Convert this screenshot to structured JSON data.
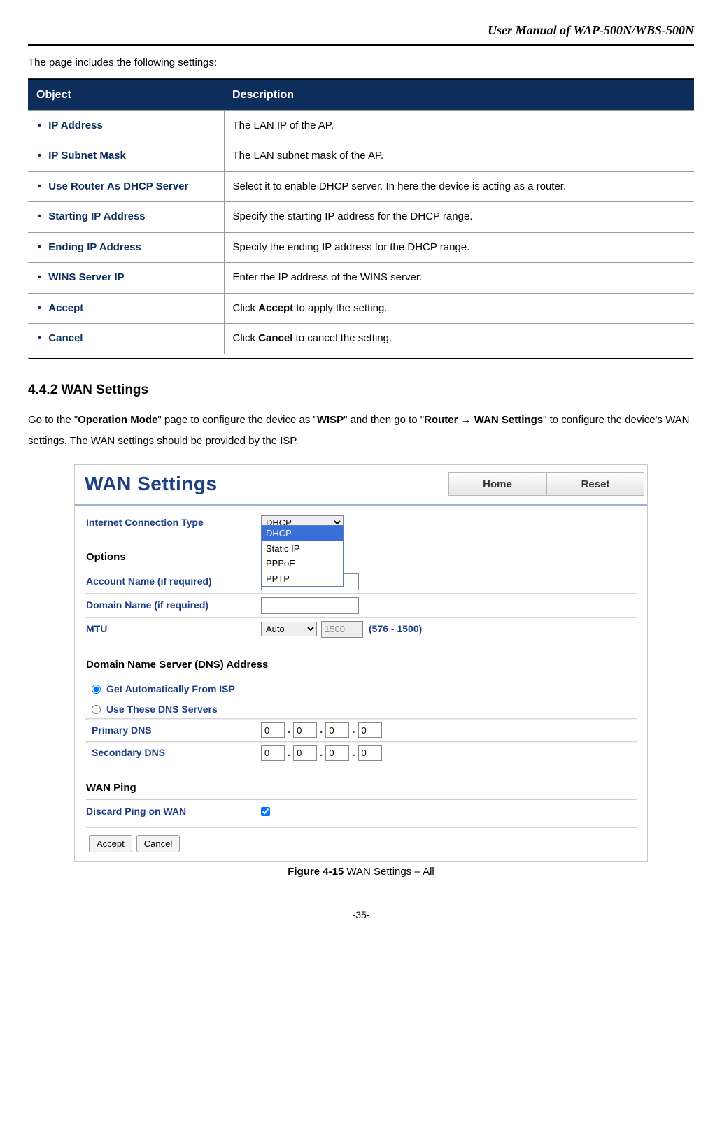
{
  "header": {
    "manual_title": "User Manual of WAP-500N/WBS-500N"
  },
  "intro": {
    "settings_text": "The page includes the following settings:"
  },
  "objtable": {
    "head_object": "Object",
    "head_desc": "Description",
    "rows": [
      {
        "obj": "IP Address",
        "desc": "The LAN IP of the AP."
      },
      {
        "obj": "IP Subnet Mask",
        "desc": "The LAN subnet mask of the AP."
      },
      {
        "obj": "Use Router As DHCP Server",
        "desc": "Select it to enable DHCP server. In here the device is acting as a router."
      },
      {
        "obj": "Starting IP Address",
        "desc": "Specify the starting IP address for the DHCP range."
      },
      {
        "obj": "Ending IP Address",
        "desc": "Specify the ending IP address for the DHCP range."
      },
      {
        "obj": "WINS Server IP",
        "desc": "Enter the IP address of the WINS server."
      },
      {
        "obj": "Accept",
        "desc_pre": "Click ",
        "desc_bold": "Accept",
        "desc_post": " to apply the setting."
      },
      {
        "obj": "Cancel",
        "desc_pre": "Click ",
        "desc_bold": "Cancel",
        "desc_post": " to cancel the setting."
      }
    ]
  },
  "section": {
    "heading": "4.4.2   WAN Settings",
    "body_pre": "Go to the \"",
    "body_b1": "Operation Mode",
    "body_mid1": "\" page to configure the device as \"",
    "body_b2": "WISP",
    "body_mid2": "\" and then go to \"",
    "body_b3": "Router ",
    "body_arrow": "→",
    "body_b4": " WAN Settings",
    "body_post": "\" to configure the device's WAN settings. The WAN settings should be provided by the ISP."
  },
  "wan": {
    "title": "WAN Settings",
    "btn_home": "Home",
    "btn_reset": "Reset",
    "labels": {
      "ict": "Internet Connection Type",
      "options": "Options",
      "account": "Account Name (if required)",
      "domain": "Domain Name (if required)",
      "mtu": "MTU",
      "mtu_range": "(576 - 1500)",
      "dns_section": "Domain Name Server (DNS) Address",
      "dns_auto": "Get Automatically From ISP",
      "dns_use": "Use These DNS Servers",
      "primary_dns": "Primary DNS",
      "secondary_dns": "Secondary DNS",
      "wan_ping": "WAN Ping",
      "discard_ping": "Discard Ping on WAN"
    },
    "select_ict": "DHCP",
    "ict_options": [
      "DHCP",
      "Static IP",
      "PPPoE",
      "PPTP"
    ],
    "mtu_mode": "Auto",
    "mtu_value": "1500",
    "dns_primary": [
      "0",
      "0",
      "0",
      "0"
    ],
    "dns_secondary": [
      "0",
      "0",
      "0",
      "0"
    ],
    "btn_accept": "Accept",
    "btn_cancel": "Cancel"
  },
  "figure": {
    "label": "Figure 4-15",
    "caption": " WAN Settings – All"
  },
  "page_number": "-35-"
}
